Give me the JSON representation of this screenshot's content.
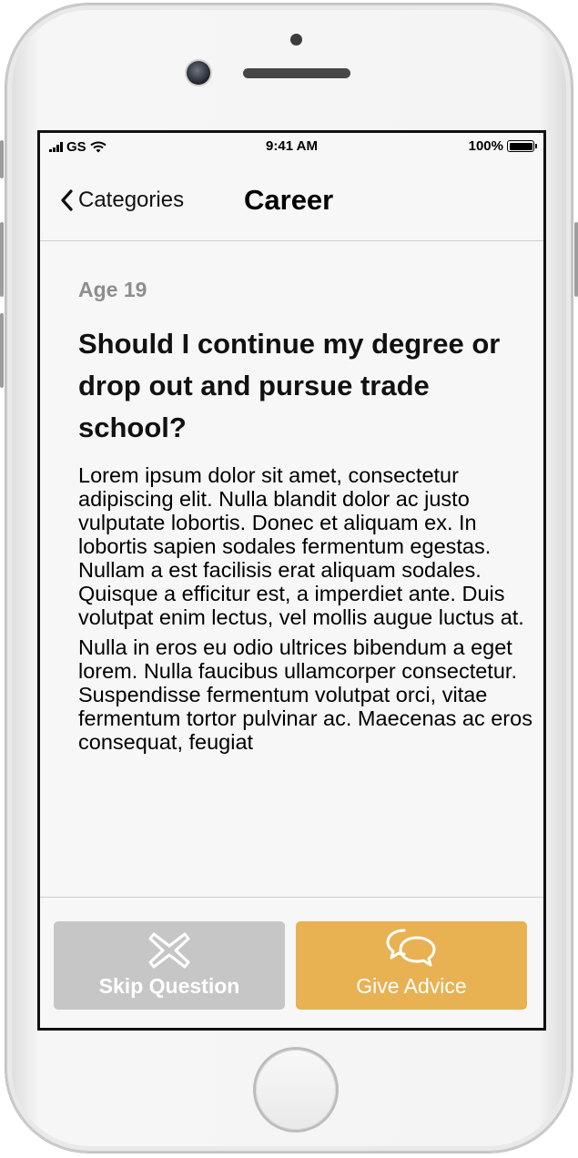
{
  "status_bar": {
    "carrier": "GS",
    "time": "9:41 AM",
    "battery": "100%"
  },
  "nav": {
    "back_label": "Categories",
    "title": "Career"
  },
  "question": {
    "age": "Age 19",
    "title": "Should I continue my degree or drop out and pursue trade school?",
    "paragraphs": [
      "Lorem ipsum dolor sit amet, consectetur adipiscing elit. Nulla blandit dolor ac justo vulputate lobortis. Donec et aliquam ex. In lobortis sapien sodales fermentum egestas. Nullam a est facilisis erat aliquam sodales. Quisque a efficitur est, a imperdiet ante. Duis volutpat enim lectus, vel mollis augue luctus at.",
      "Nulla in eros eu odio ultrices bibendum a eget lorem. Nulla faucibus ullamcorper consectetur. Suspendisse fermentum volutpat orci, vitae fermentum tortor pulvinar ac. Maecenas ac eros consequat, feugiat"
    ]
  },
  "actions": {
    "skip_label": "Skip Question",
    "skip_icon": "close-x-icon",
    "skip_color": "#c6c6c6",
    "advice_label": "Give Advice",
    "advice_icon": "chat-bubbles-icon",
    "advice_color": "#e8b152"
  }
}
